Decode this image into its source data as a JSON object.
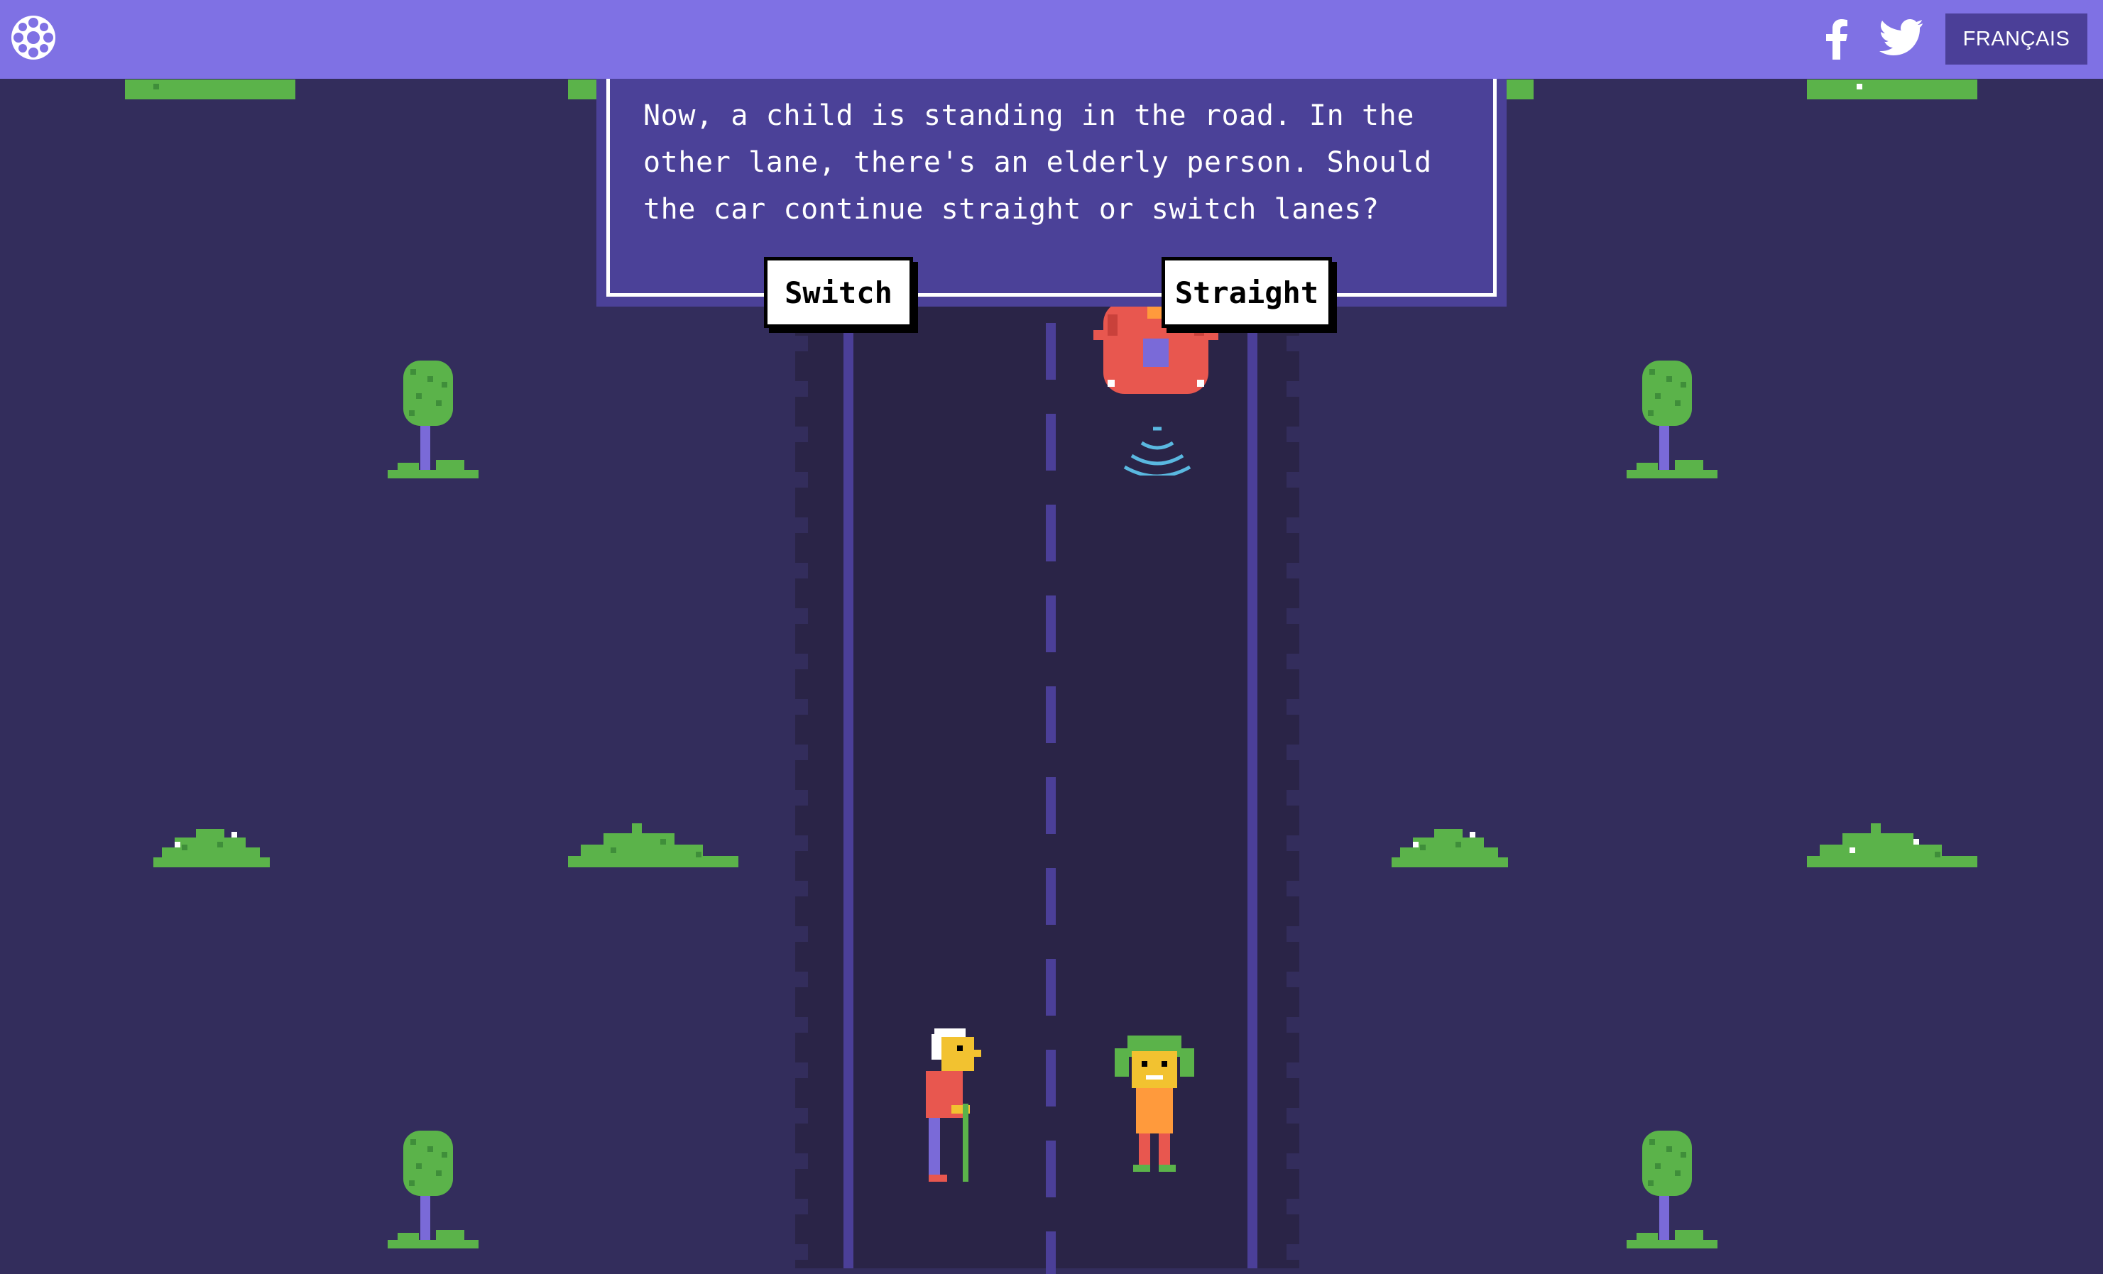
{
  "header": {
    "logo_icon": "cbc-gem-icon",
    "share_facebook_icon": "facebook-icon",
    "share_twitter_icon": "twitter-icon",
    "language_button": "FRANÇAIS"
  },
  "dialog": {
    "prompt": "Now, a child is standing in the road. In the other lane, there's an elderly person. Should the car continue straight or switch lanes?",
    "choices": {
      "switch": "Switch",
      "straight": "Straight"
    }
  },
  "scene": {
    "characters": [
      "elderly-person",
      "child"
    ],
    "vehicle": "self-driving-car"
  },
  "colors": {
    "header": "#7f71e4",
    "background": "#332d5c",
    "road": "#2a2447",
    "dialog": "#4b4198",
    "car": "#e8574f"
  }
}
